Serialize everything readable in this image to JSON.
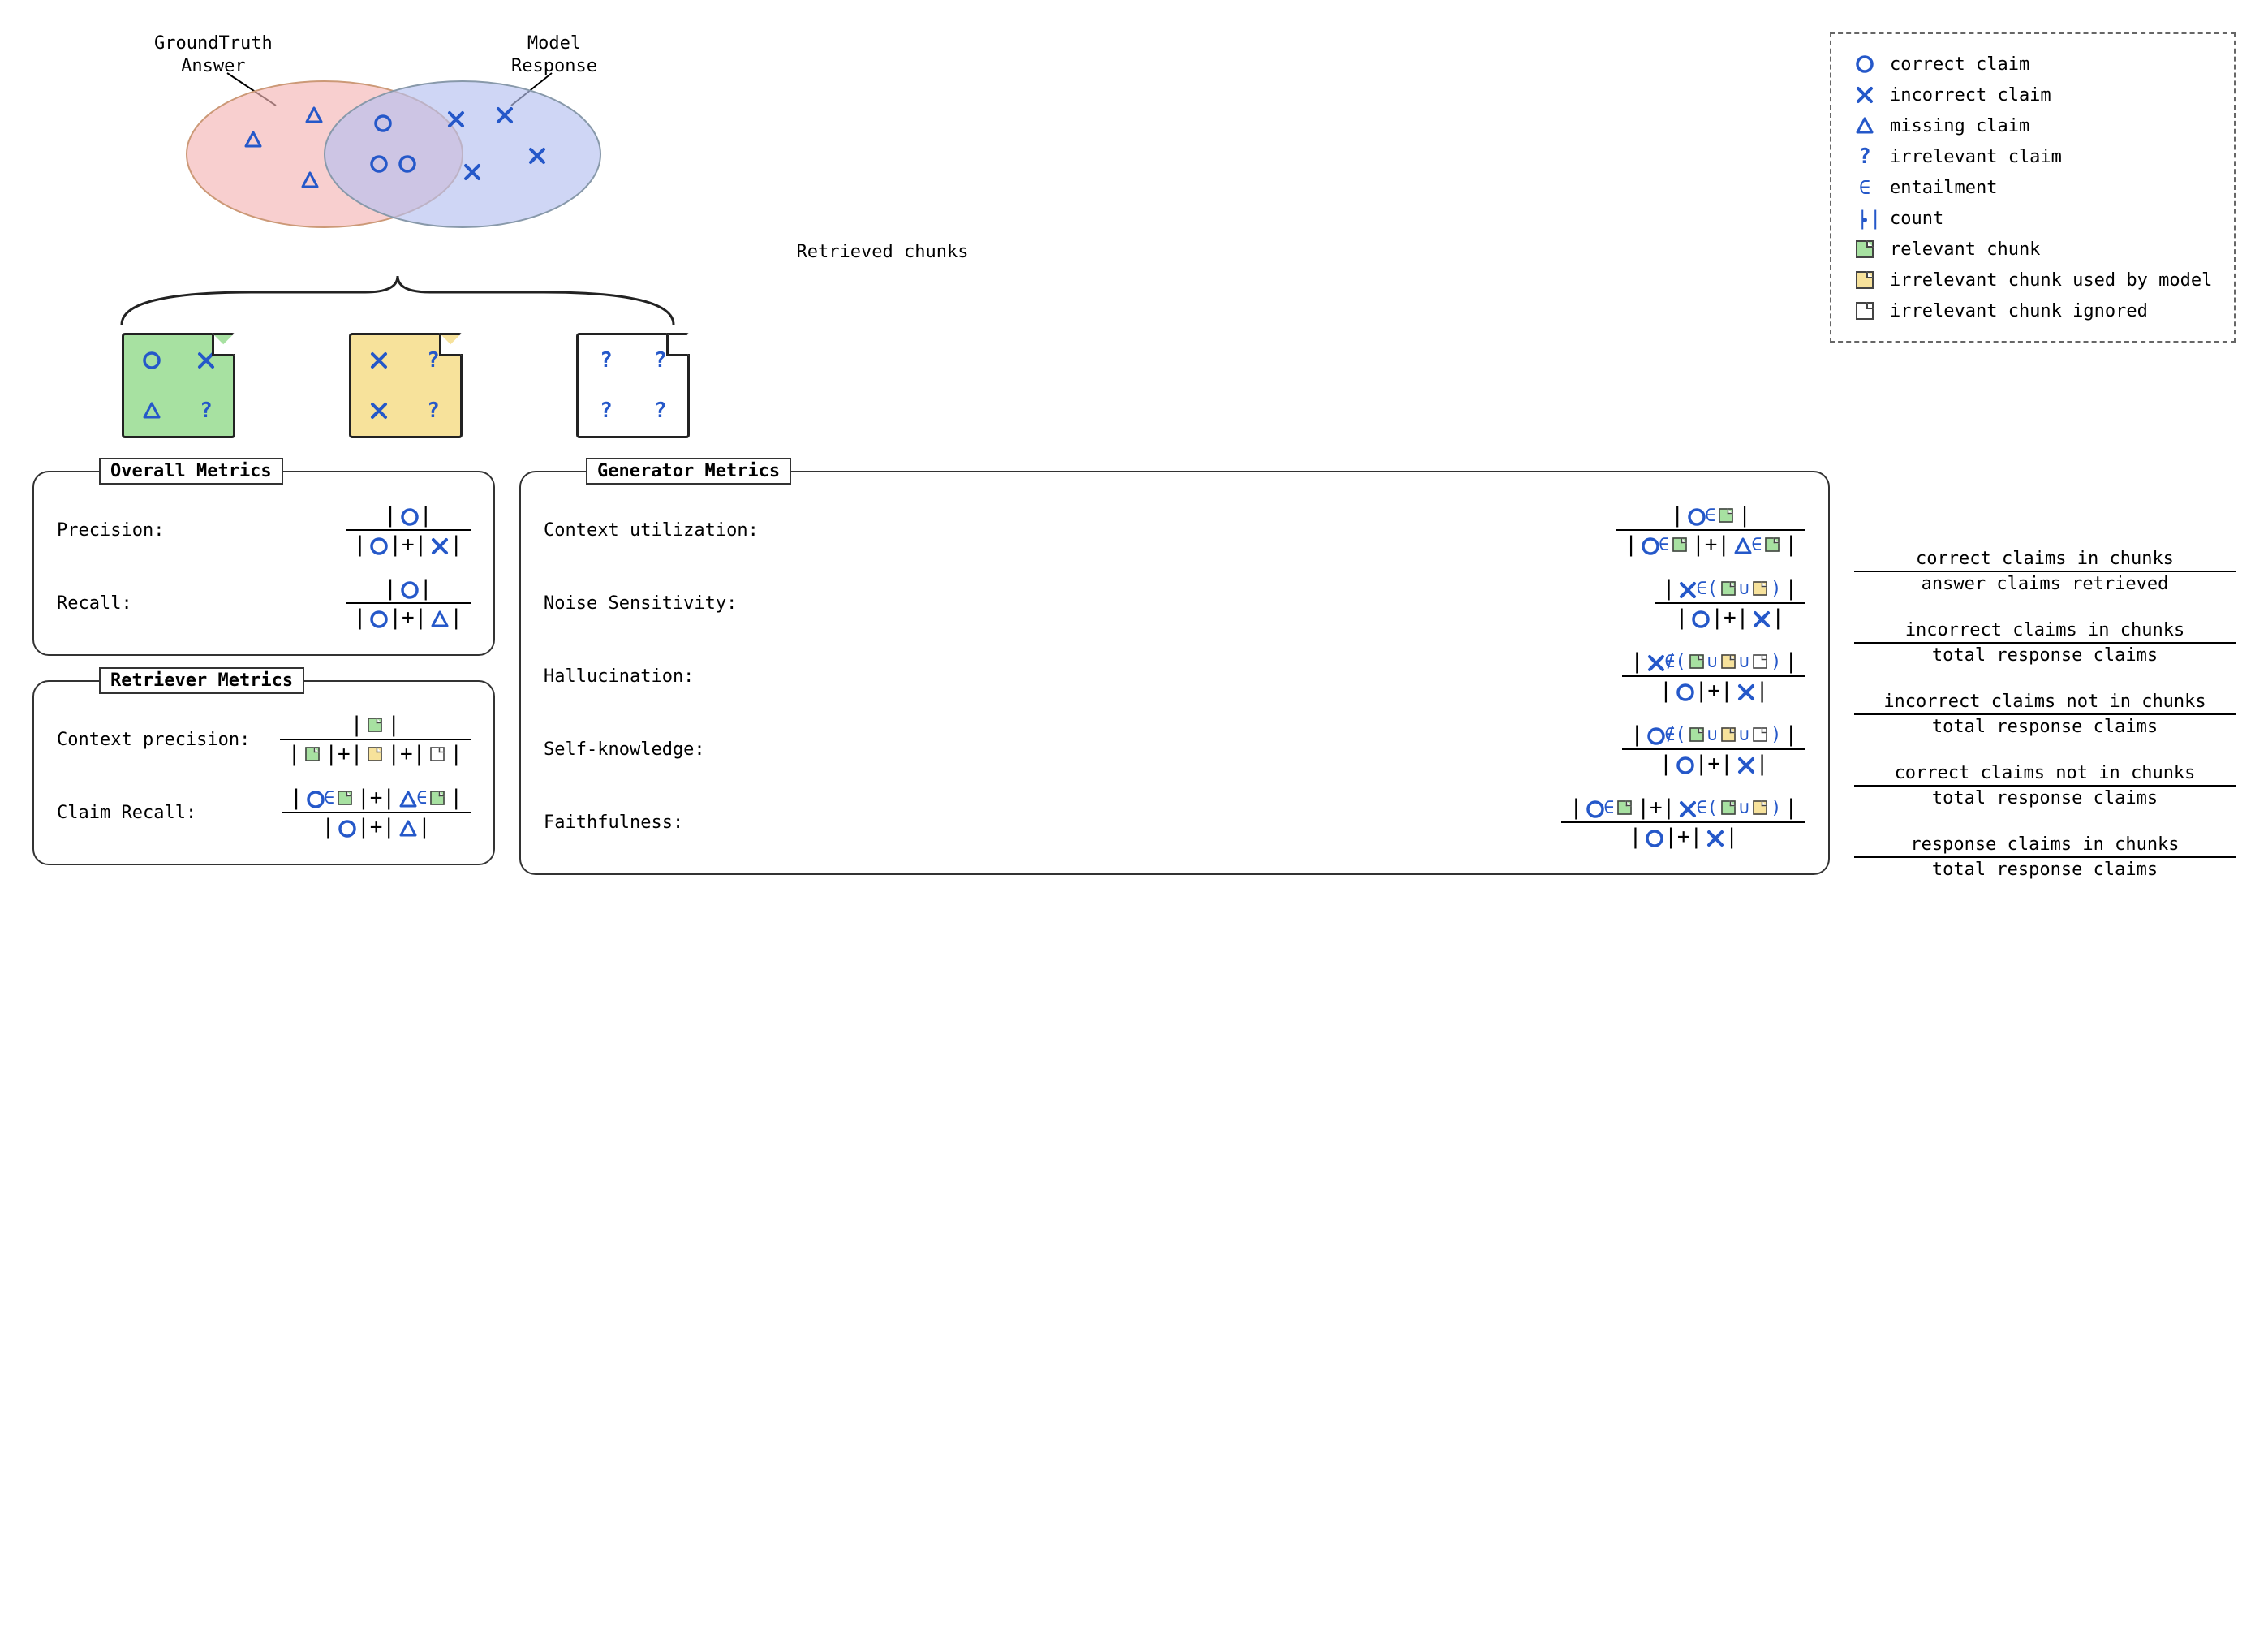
{
  "venn": {
    "label_left_1": "GroundTruth",
    "label_left_2": "Answer",
    "label_right_1": "Model",
    "label_right_2": "Response",
    "retrieved_label": "Retrieved chunks"
  },
  "legend": {
    "correct": "correct claim",
    "incorrect": "incorrect claim",
    "missing": "missing claim",
    "irrelevant": "irrelevant claim",
    "entailment": "entailment",
    "count": "count",
    "relevant_chunk": "relevant chunk",
    "irrelevant_used": "irrelevant chunk used by model",
    "irrelevant_ignored": "irrelevant chunk ignored"
  },
  "overall": {
    "title": "Overall Metrics",
    "precision": "Precision:",
    "recall": "Recall:"
  },
  "retriever": {
    "title": "Retriever Metrics",
    "context_precision": "Context precision:",
    "claim_recall": "Claim Recall:"
  },
  "generator": {
    "title": "Generator Metrics",
    "context_util": "Context utilization:",
    "noise": "Noise Sensitivity:",
    "hallucination": "Hallucination:",
    "selfknowledge": "Self-knowledge:",
    "faithfulness": "Faithfulness:"
  },
  "descriptions": {
    "context_util_num": "correct claims in chunks",
    "context_util_den": "answer claims retrieved",
    "noise_num": "incorrect claims in chunks",
    "noise_den": "total response claims",
    "hall_num": "incorrect claims not in chunks",
    "hall_den": "total response claims",
    "selfk_num": "correct claims not in chunks",
    "selfk_den": "total response claims",
    "faith_num": "response claims in chunks",
    "faith_den": "total response claims"
  },
  "chart_data": {
    "type": "diagram",
    "venn": {
      "ground_truth_only": [
        "missing",
        "missing",
        "missing"
      ],
      "intersection": [
        "correct",
        "correct",
        "correct"
      ],
      "model_only": [
        "incorrect",
        "incorrect",
        "incorrect",
        "incorrect"
      ]
    },
    "chunks": [
      {
        "kind": "relevant",
        "cells": [
          "correct",
          "incorrect",
          "missing",
          "irrelevant"
        ]
      },
      {
        "kind": "irrelevant_used",
        "cells": [
          "incorrect",
          "irrelevant",
          "incorrect",
          "irrelevant"
        ]
      },
      {
        "kind": "irrelevant_ignored",
        "cells": [
          "irrelevant",
          "irrelevant",
          "irrelevant",
          "irrelevant"
        ]
      }
    ],
    "metrics": {
      "Precision": "|correct| / (|correct|+|incorrect|)",
      "Recall": "|correct| / (|correct|+|missing|)",
      "Context precision": "|relevant| / (|relevant|+|irrelevant_used|+|irrelevant_ignored|)",
      "Claim Recall": "(|correct ∈ relevant|+|missing ∈ relevant|) / (|correct|+|missing|)",
      "Context utilization": "|correct ∈ relevant| / (|correct ∈ relevant|+|missing ∈ relevant|)",
      "Noise Sensitivity": "|incorrect ∈ (relevant ∪ irrelevant_used)| / (|correct|+|incorrect|)",
      "Hallucination": "|incorrect ∉ (relevant ∪ irrelevant_used ∪ irrelevant_ignored)| / (|correct|+|incorrect|)",
      "Self-knowledge": "|correct ∉ (relevant ∪ irrelevant_used ∪ irrelevant_ignored)| / (|correct|+|incorrect|)",
      "Faithfulness": "(|correct ∈ relevant|+|incorrect ∈ (relevant ∪ irrelevant_used)|) / (|correct|+|incorrect|)"
    }
  }
}
